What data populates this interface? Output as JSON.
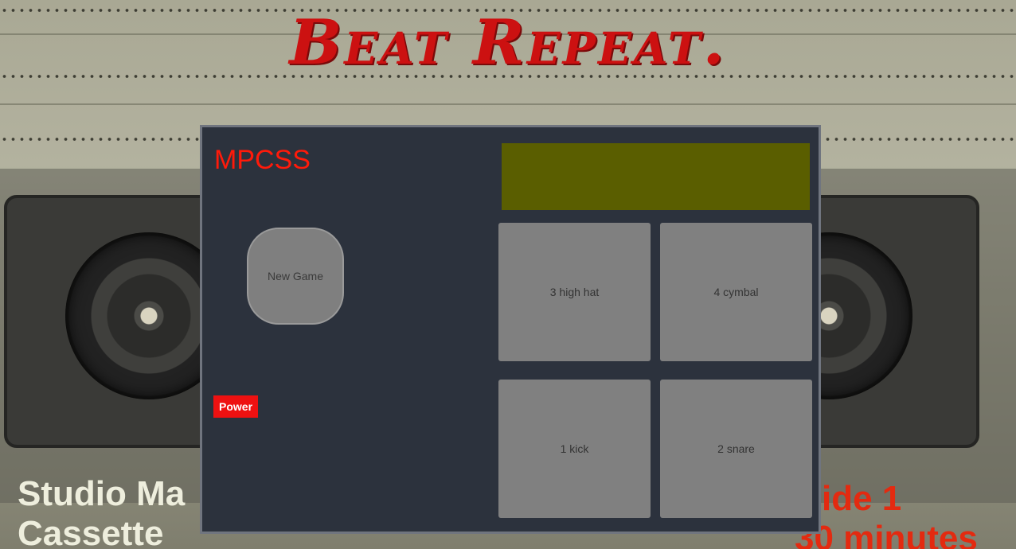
{
  "header": {
    "title": "Beat Repeat."
  },
  "background": {
    "left_label_line1": "Studio Ma",
    "left_label_line2": "Cassette",
    "right_label_line1": "ide 1",
    "right_label_line2": "30 minutes"
  },
  "console": {
    "brand": "MPCSS",
    "display_text": "",
    "new_game_label": "New Game",
    "power_label": "Power",
    "pads": [
      {
        "label": "3 high hat"
      },
      {
        "label": "4 cymbal"
      },
      {
        "label": "1 kick"
      },
      {
        "label": "2 snare"
      }
    ]
  },
  "colors": {
    "title_red": "#cc1111",
    "brand_red": "#ff1a0a",
    "display_olive": "#5a5e00",
    "panel": "#2c323d",
    "pad_gray": "#808080",
    "power_red": "#ee1111"
  }
}
